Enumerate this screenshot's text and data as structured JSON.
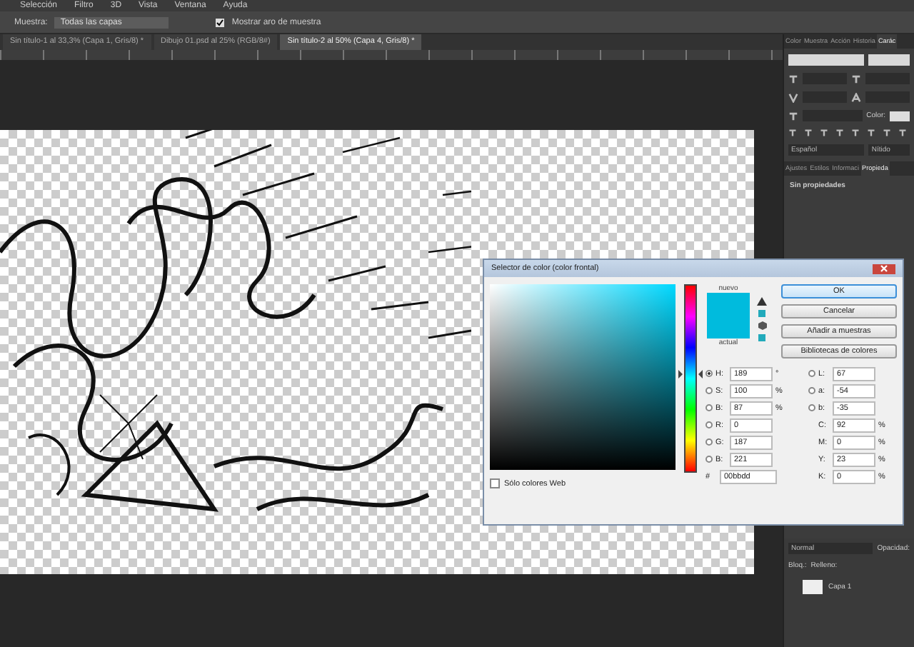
{
  "menu": [
    "Selección",
    "Filtro",
    "3D",
    "Vista",
    "Ventana",
    "Ayuda"
  ],
  "options_bar": {
    "sample_label": "Muestra:",
    "sample_value": "Todas las capas",
    "show_ring": {
      "label": "Mostrar aro de muestra",
      "checked": true
    }
  },
  "document_tabs": [
    {
      "label": "Sin título-1 al 33,3% (Capa 1, Gris/8) *",
      "selected": false
    },
    {
      "label": "Dibujo 01.psd al 25% (RGB/8#)",
      "selected": false
    },
    {
      "label": "Sin título-2 al 50% (Capa 4, Gris/8) *",
      "selected": true
    }
  ],
  "panel_tabs": [
    {
      "label": "Color",
      "selected": false
    },
    {
      "label": "Muestra",
      "selected": false
    },
    {
      "label": "Acción",
      "selected": false
    },
    {
      "label": "Historia",
      "selected": false
    },
    {
      "label": "Carác",
      "selected": true
    }
  ],
  "character": {
    "color_label": "Color:",
    "language": "Español",
    "antialias": "Nítido"
  },
  "properties_tabs": [
    {
      "label": "Ajustes",
      "selected": false
    },
    {
      "label": "Estilos",
      "selected": false
    },
    {
      "label": "Informaci",
      "selected": false
    },
    {
      "label": "Propieda",
      "selected": true
    }
  ],
  "properties_text": "Sin propiedades",
  "layers": {
    "blend_mode": "Normal",
    "opacity_label": "Opacidad:",
    "lock_label": "Bloq.:",
    "fill_label": "Relleno:",
    "layer_names": [
      "Capa 1"
    ]
  },
  "color_picker": {
    "title": "Selector de color (color frontal)",
    "new_label": "nuevo",
    "current_label": "actual",
    "buttons": [
      {
        "label": "OK",
        "default": true
      },
      {
        "label": "Cancelar",
        "default": false
      },
      {
        "label": "Añadir a muestras",
        "default": false
      },
      {
        "label": "Bibliotecas de colores",
        "default": false
      }
    ],
    "fields_left": [
      {
        "kind": "radio",
        "label": "H:",
        "value": "189",
        "unit": "°",
        "selected": true
      },
      {
        "kind": "radio",
        "label": "S:",
        "value": "100",
        "unit": "%",
        "selected": false
      },
      {
        "kind": "radio",
        "label": "B:",
        "value": "87",
        "unit": "%",
        "selected": false
      },
      {
        "kind": "radio",
        "label": "R:",
        "value": "0",
        "selected": false
      },
      {
        "kind": "radio",
        "label": "G:",
        "value": "187",
        "selected": false
      },
      {
        "kind": "radio",
        "label": "B:",
        "value": "221",
        "selected": false
      }
    ],
    "fields_right": [
      {
        "kind": "radio",
        "label": "L:",
        "value": "67",
        "selected": false
      },
      {
        "kind": "radio",
        "label": "a:",
        "value": "-54",
        "selected": false
      },
      {
        "kind": "radio",
        "label": "b:",
        "value": "-35",
        "selected": false
      },
      {
        "kind": "plain",
        "label": "C:",
        "value": "92",
        "unit": "%"
      },
      {
        "kind": "plain",
        "label": "M:",
        "value": "0",
        "unit": "%"
      },
      {
        "kind": "plain",
        "label": "Y:",
        "value": "23",
        "unit": "%"
      },
      {
        "kind": "plain",
        "label": "K:",
        "value": "0",
        "unit": "%"
      }
    ],
    "hue_slider": {
      "level": 0.475
    },
    "hex_label": "#",
    "hex": "00bbdd",
    "web_only": {
      "label": "Sólo colores Web",
      "checked": false
    }
  }
}
